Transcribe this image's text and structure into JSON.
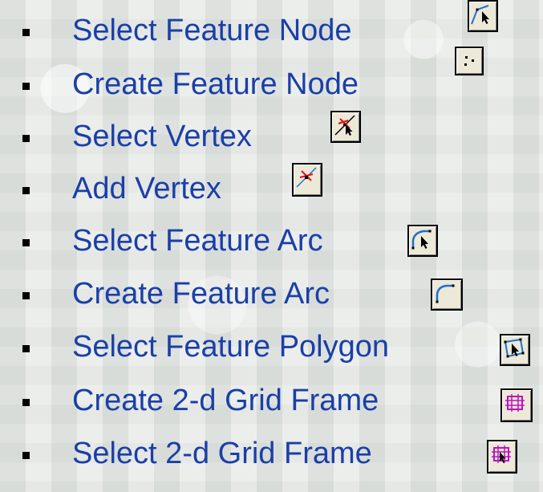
{
  "items": [
    {
      "label": "Select Feature Node",
      "icon": "select-feature-node-icon"
    },
    {
      "label": "Create Feature Node",
      "icon": "create-feature-node-icon"
    },
    {
      "label": "Select Vertex",
      "icon": "select-vertex-icon"
    },
    {
      "label": "Add Vertex",
      "icon": "add-vertex-icon"
    },
    {
      "label": "Select Feature Arc",
      "icon": "select-feature-arc-icon"
    },
    {
      "label": "Create Feature Arc",
      "icon": "create-feature-arc-icon"
    },
    {
      "label": "Select Feature Polygon",
      "icon": "select-feature-polygon-icon"
    },
    {
      "label": "Create 2-d Grid Frame",
      "icon": "create-2d-grid-frame-icon"
    },
    {
      "label": "Select 2-d Grid Frame",
      "icon": "select-2d-grid-frame-icon"
    }
  ],
  "colors": {
    "label_text": "#1a3fa8",
    "icon_face": "#ece9d8",
    "arc_blue": "#1f6fd0",
    "grid_magenta": "#c010c0",
    "vertex_red": "#e01010"
  }
}
